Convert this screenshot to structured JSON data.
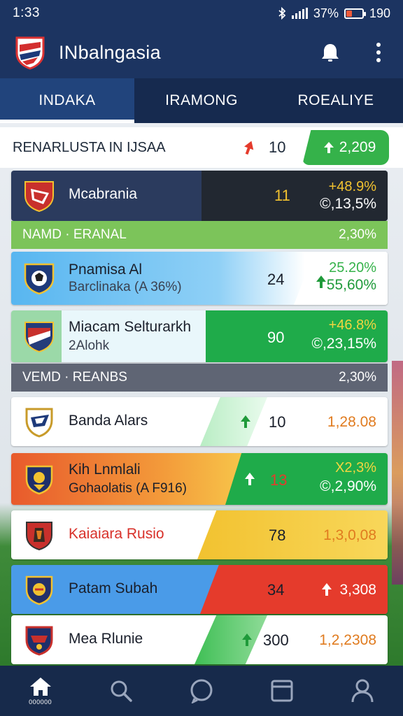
{
  "status": {
    "time": "1:33",
    "battery_text": "37%",
    "extra": "190"
  },
  "app": {
    "title": "INbalngasia"
  },
  "tabs": [
    {
      "label": "INDAKA",
      "active": true
    },
    {
      "label": "IRAMONG",
      "active": false
    },
    {
      "label": "ROEALIYE",
      "active": false
    }
  ],
  "header": {
    "title": "RENARLUSTA IN IJSAA",
    "count": "10",
    "pill": "2,209"
  },
  "cards": [
    {
      "name": "Mcabrania",
      "sub": "",
      "num": "11",
      "right_top": "+48.9%",
      "right_bot": "©,13,5%"
    },
    {
      "name": "Pnamisa Al",
      "sub": "Barclinaka (A 36%)",
      "num": "24",
      "right_top": "25.20%",
      "right_bot": "55,60%"
    },
    {
      "name": "Miacam Selturarkh",
      "sub": "2Alohk",
      "num": "90",
      "right_top": "+46.8%",
      "right_bot": "©,23,15%"
    },
    {
      "name": "Banda Alars",
      "sub": "",
      "num": "10",
      "right_mid": "1,28.08"
    },
    {
      "name": "Kih Lnmlali",
      "sub": "Gohaolatis (A F916)",
      "num": "13",
      "right_top": "X2,3%",
      "right_bot": "©,2,90%"
    },
    {
      "name": "Kaiaiara Rusio",
      "sub": "",
      "num": "78",
      "right_mid": "1,3,0,08"
    },
    {
      "name": "Patam Subah",
      "sub": "",
      "num": "34",
      "right_mid": "3,308"
    },
    {
      "name": "Mea Rlunie",
      "sub": "",
      "num": "300",
      "right_mid": "1,2,2308"
    }
  ],
  "sections": [
    {
      "label": "NAMD · ERANAL",
      "value": "2,30%"
    },
    {
      "label": "VEMD · REANBS",
      "value": "2,30%"
    }
  ],
  "nav": {
    "home_label": "000000"
  },
  "colors": {
    "primary": "#1c3461",
    "accent_green": "#35b24a",
    "accent_red": "#e53b2c",
    "accent_yellow": "#f2c230",
    "orange": "#e07b1f"
  }
}
